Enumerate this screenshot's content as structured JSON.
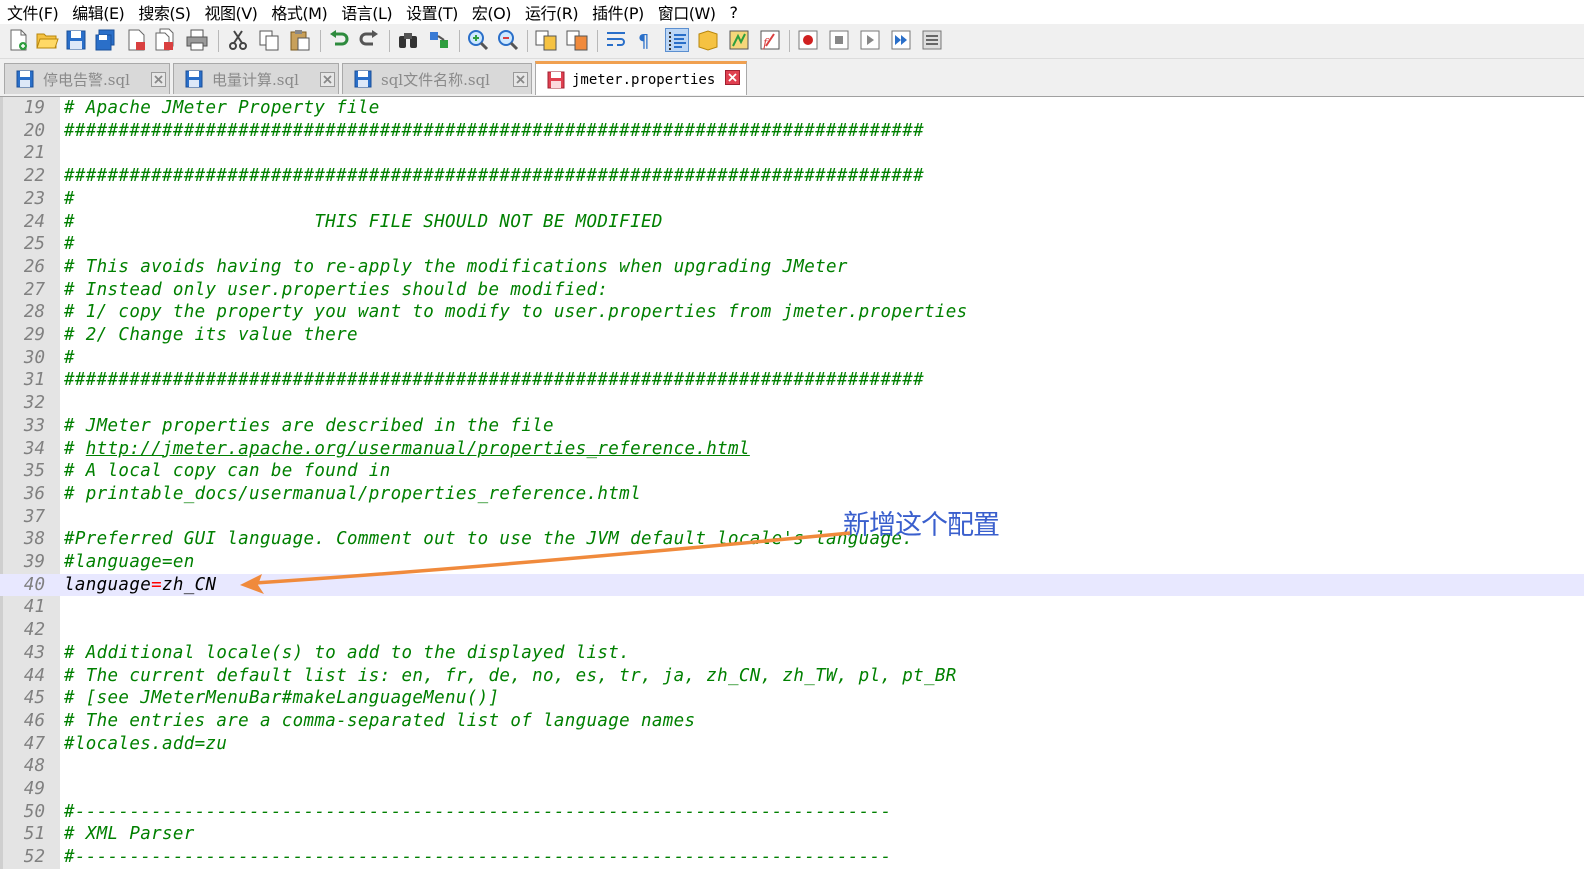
{
  "menu": [
    "文件(F)",
    "编辑(E)",
    "搜索(S)",
    "视图(V)",
    "格式(M)",
    "语言(L)",
    "设置(T)",
    "宏(O)",
    "运行(R)",
    "插件(P)",
    "窗口(W)",
    "?"
  ],
  "tabs": [
    {
      "label": "停电告警.sql",
      "active": false
    },
    {
      "label": "电量计算.sql",
      "active": false
    },
    {
      "label": "sql文件名称.sql",
      "active": false
    },
    {
      "label": "jmeter.properties",
      "active": true
    }
  ],
  "lines": [
    {
      "num": "19",
      "text": "# Apache JMeter Property file"
    },
    {
      "num": "20",
      "text": "###############################################################################"
    },
    {
      "num": "21",
      "text": ""
    },
    {
      "num": "22",
      "text": "###############################################################################"
    },
    {
      "num": "23",
      "text": "#"
    },
    {
      "num": "24",
      "text": "#                      THIS FILE SHOULD NOT BE MODIFIED"
    },
    {
      "num": "25",
      "text": "#"
    },
    {
      "num": "26",
      "text": "# This avoids having to re-apply the modifications when upgrading JMeter"
    },
    {
      "num": "27",
      "text": "# Instead only user.properties should be modified:"
    },
    {
      "num": "28",
      "text": "# 1/ copy the property you want to modify to user.properties from jmeter.properties"
    },
    {
      "num": "29",
      "text": "# 2/ Change its value there"
    },
    {
      "num": "30",
      "text": "#"
    },
    {
      "num": "31",
      "text": "###############################################################################"
    },
    {
      "num": "32",
      "text": ""
    },
    {
      "num": "33",
      "text": "# JMeter properties are described in the file"
    },
    {
      "num": "34",
      "text": "# ",
      "url": "http://jmeter.apache.org/usermanual/properties_reference.html"
    },
    {
      "num": "35",
      "text": "# A local copy can be found in"
    },
    {
      "num": "36",
      "text": "# printable_docs/usermanual/properties_reference.html"
    },
    {
      "num": "37",
      "text": ""
    },
    {
      "num": "38",
      "text": "#Preferred GUI language. Comment out to use the JVM default locale's language."
    },
    {
      "num": "39",
      "text": "#language=en"
    },
    {
      "num": "40",
      "key": "language",
      "value": "zh_CN",
      "current": true
    },
    {
      "num": "41",
      "text": ""
    },
    {
      "num": "42",
      "text": ""
    },
    {
      "num": "43",
      "text": "# Additional locale(s) to add to the displayed list."
    },
    {
      "num": "44",
      "text": "# The current default list is: en, fr, de, no, es, tr, ja, zh_CN, zh_TW, pl, pt_BR"
    },
    {
      "num": "45",
      "text": "# [see JMeterMenuBar#makeLanguageMenu()]"
    },
    {
      "num": "46",
      "text": "# The entries are a comma-separated list of language names"
    },
    {
      "num": "47",
      "text": "#locales.add=zu"
    },
    {
      "num": "48",
      "text": ""
    },
    {
      "num": "49",
      "text": ""
    },
    {
      "num": "50",
      "text": "#---------------------------------------------------------------------------"
    },
    {
      "num": "51",
      "text": "# XML Parser"
    },
    {
      "num": "52",
      "text": "#---------------------------------------------------------------------------"
    }
  ],
  "annotation": {
    "text": "新增这个配置",
    "color": "#3a5fcd",
    "arrow_color": "#f08a3c"
  },
  "colors": {
    "comment": "#008000",
    "line_number": "#808080",
    "current_line": "#e8e8ff",
    "equals": "#ff0000"
  }
}
